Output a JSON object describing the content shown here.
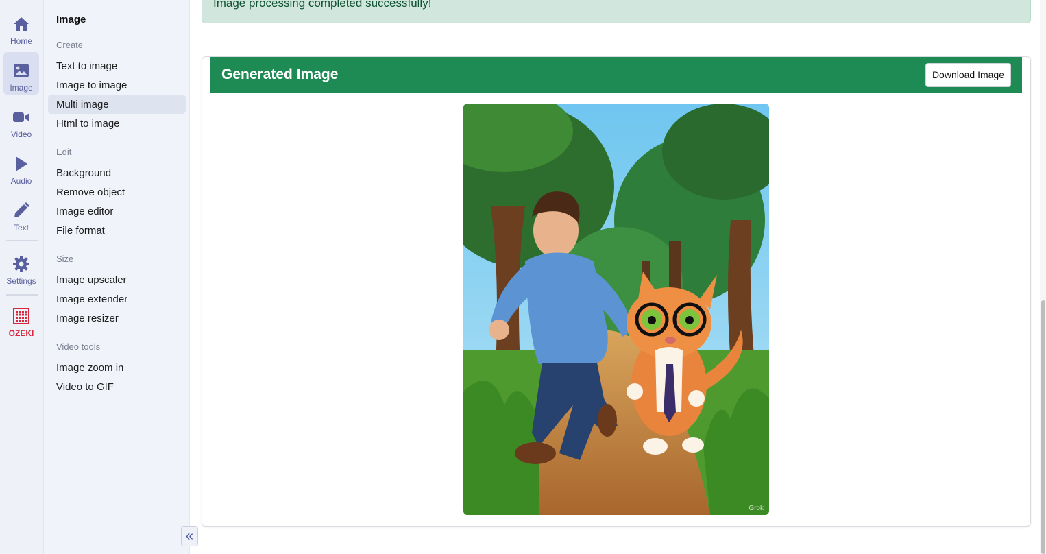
{
  "rail": {
    "items": [
      {
        "label": "Home",
        "icon": "home-icon"
      },
      {
        "label": "Image",
        "icon": "image-icon"
      },
      {
        "label": "Video",
        "icon": "video-camera-icon"
      },
      {
        "label": "Audio",
        "icon": "play-icon"
      },
      {
        "label": "Text",
        "icon": "pencil-icon"
      },
      {
        "label": "Settings",
        "icon": "gear-icon"
      },
      {
        "label": "OZEKI",
        "icon": "ozeki-logo"
      }
    ],
    "active": "Image"
  },
  "submenu": {
    "title": "Image",
    "groups": [
      {
        "label": "Create",
        "items": [
          "Text to image",
          "Image to image",
          "Multi image",
          "Html to image"
        ]
      },
      {
        "label": "Edit",
        "items": [
          "Background",
          "Remove object",
          "Image editor",
          "File format"
        ]
      },
      {
        "label": "Size",
        "items": [
          "Image upscaler",
          "Image extender",
          "Image resizer"
        ]
      },
      {
        "label": "Video tools",
        "items": [
          "Image zoom in",
          "Video to GIF"
        ]
      }
    ],
    "active_item": "Multi image"
  },
  "alert": {
    "text": "Image processing completed successfully!"
  },
  "card": {
    "title": "Generated Image",
    "download_label": "Download Image",
    "watermark": "Grok"
  },
  "colors": {
    "accent": "#5a5f9e",
    "header_green": "#1e8b55",
    "alert_bg": "#d1e7dd",
    "ozeki_red": "#d7263d"
  }
}
